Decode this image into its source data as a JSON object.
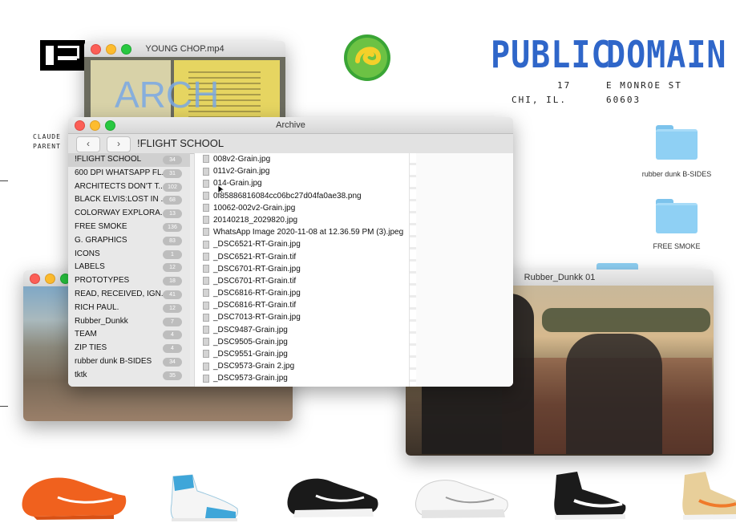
{
  "header": {
    "title_public": "PUBLIC",
    "title_domain": "DOMAIN",
    "addr_num": "17",
    "addr_street": "E MONROE ST",
    "addr_city": "CHI, IL.",
    "addr_zip": "60603"
  },
  "desktop": {
    "left_caption_1": "CLAUDE",
    "left_caption_2": "PARENT",
    "folders": [
      {
        "label": "rubber dunk B-SIDES"
      },
      {
        "label": "FREE SMOKE"
      }
    ]
  },
  "video_window": {
    "title": "YOUNG CHOP.mp4",
    "overlay_text": "ARCH"
  },
  "archive": {
    "title": "Archive",
    "back_label": "‹",
    "forward_label": "›",
    "current_folder": "!FLIGHT SCHOOL",
    "sidebar": [
      {
        "label": "!FLIGHT SCHOOL",
        "count": "34"
      },
      {
        "label": "600 DPI WHATSAPP FL...",
        "count": "31"
      },
      {
        "label": "ARCHITECTS DON'T T...",
        "count": "102"
      },
      {
        "label": "BLACK ELVIS:LOST IN ...",
        "count": "68"
      },
      {
        "label": "COLORWAY EXPLORA...",
        "count": "13"
      },
      {
        "label": "FREE SMOKE",
        "count": "136"
      },
      {
        "label": "G. GRAPHICS",
        "count": "83"
      },
      {
        "label": "ICONS",
        "count": "1"
      },
      {
        "label": "LABELS",
        "count": "12"
      },
      {
        "label": "PROTOTYPES",
        "count": "18"
      },
      {
        "label": "READ, RECEIVED, IGN...",
        "count": "41"
      },
      {
        "label": "RICH PAUL.",
        "count": "12"
      },
      {
        "label": "Rubber_Dunkk",
        "count": "7"
      },
      {
        "label": "TEAM",
        "count": "4"
      },
      {
        "label": "ZIP TIES",
        "count": "4"
      },
      {
        "label": "rubber dunk B-SIDES",
        "count": "34"
      },
      {
        "label": "tktk",
        "count": "35"
      }
    ],
    "files": [
      "008v2-Grain.jpg",
      "011v2-Grain.jpg",
      "014-Grain.jpg",
      "0f85886816084cc06bc27d04fa0ae38.png",
      "10062-002v2-Grain.jpg",
      "20140218_2029820.jpg",
      "WhatsApp Image 2020-11-08 at 12.36.59 PM (3).jpeg",
      "_DSC6521-RT-Grain.jpg",
      "_DSC6521-RT-Grain.tif",
      "_DSC6701-RT-Grain.jpg",
      "_DSC6701-RT-Grain.tif",
      "_DSC6816-RT-Grain.jpg",
      "_DSC6816-RT-Grain.tif",
      "_DSC7013-RT-Grain.jpg",
      "_DSC9487-Grain.jpg",
      "_DSC9505-Grain.jpg",
      "_DSC9551-Grain.jpg",
      "_DSC9573-Grain 2.jpg",
      "_DSC9573-Grain.jpg"
    ]
  },
  "rubber_window": {
    "title": "Rubber_Dunkk 01"
  },
  "colors": {
    "accent_blue": "#2f66c9",
    "folder_blue": "#8fd0f4"
  }
}
